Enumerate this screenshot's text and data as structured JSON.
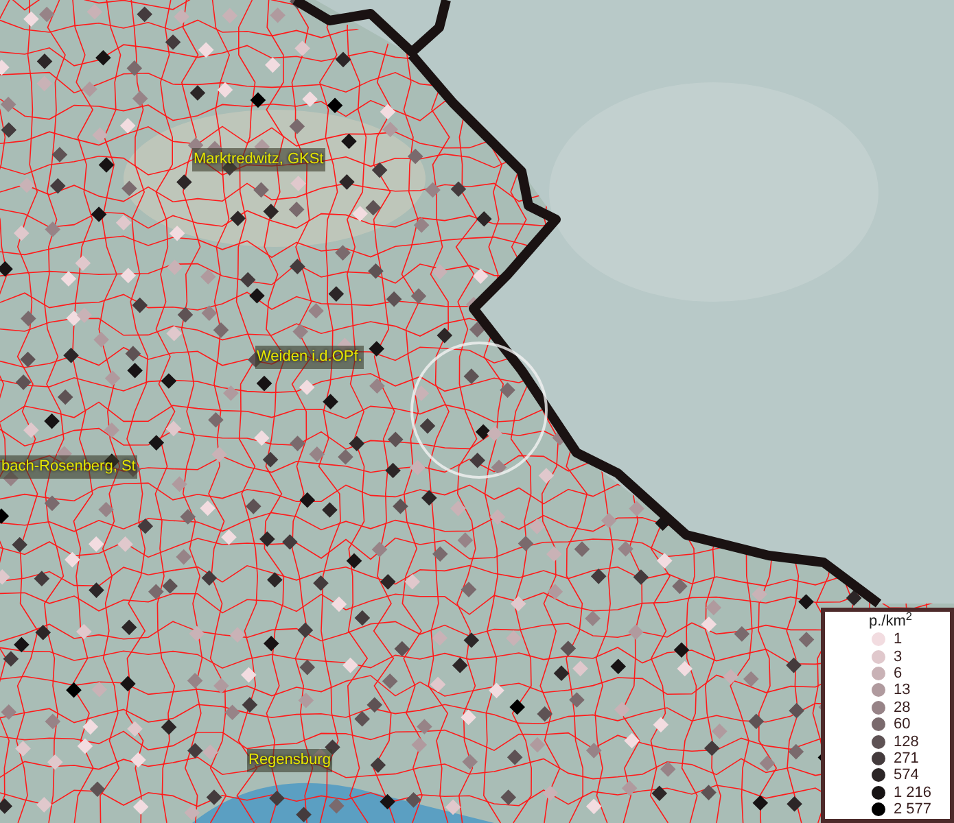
{
  "map": {
    "labels": [
      {
        "text": "Marktredwitz, GKSt"
      },
      {
        "text": "Weiden i.d.OPf."
      },
      {
        "text": "bach-Rosenberg, St"
      },
      {
        "text": "Regensburg"
      }
    ]
  },
  "legend": {
    "title": "p./km$^{2}$",
    "items": [
      {
        "label": "1",
        "color": "#f2dce0"
      },
      {
        "label": "3",
        "color": "#e0c8cc"
      },
      {
        "label": "6",
        "color": "#c9b2b6"
      },
      {
        "label": "13",
        "color": "#b09a9e"
      },
      {
        "label": "28",
        "color": "#978387"
      },
      {
        "label": "60",
        "color": "#7a6a6d"
      },
      {
        "label": "128",
        "color": "#5e5254"
      },
      {
        "label": "271",
        "color": "#443b3d"
      },
      {
        "label": "574",
        "color": "#2c2627"
      },
      {
        "label": "1 216",
        "color": "#171314"
      },
      {
        "label": "2 577",
        "color": "#000000"
      }
    ]
  }
}
